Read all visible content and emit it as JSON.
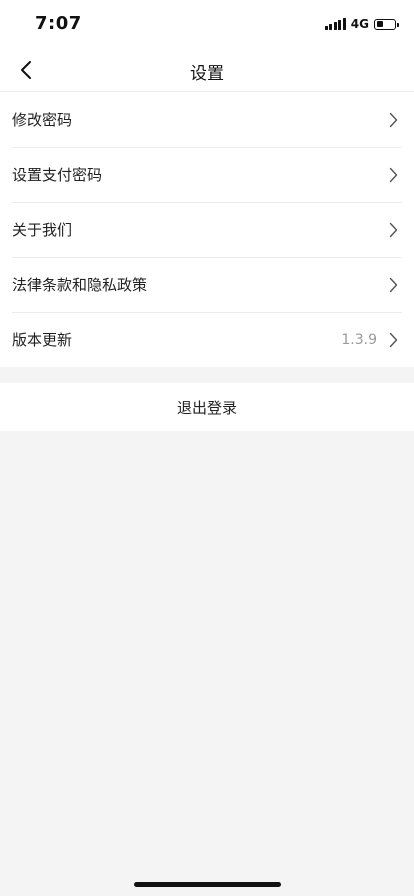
{
  "status_bar": {
    "time": "7:07",
    "network": "4G",
    "signal_icon": "signal-bars-icon",
    "battery_icon": "battery-icon",
    "battery_level": 0.4
  },
  "nav": {
    "back_icon": "chevron-left-icon",
    "title": "设置"
  },
  "settings": {
    "items": [
      {
        "label": "修改密码",
        "value": ""
      },
      {
        "label": "设置支付密码",
        "value": ""
      },
      {
        "label": "关于我们",
        "value": ""
      },
      {
        "label": "法律条款和隐私政策",
        "value": ""
      },
      {
        "label": "版本更新",
        "value": "1.3.9"
      }
    ],
    "chevron_icon": "chevron-right-icon"
  },
  "logout": {
    "label": "退出登录"
  },
  "colors": {
    "page_background": "#f4f4f4",
    "card_background": "#ffffff",
    "divider": "#ececec",
    "secondary_text": "#9a9a9a"
  }
}
